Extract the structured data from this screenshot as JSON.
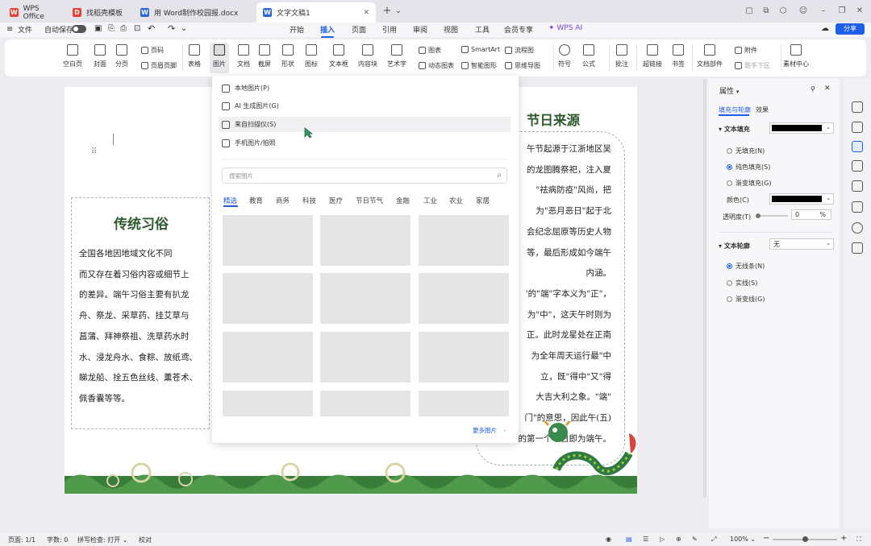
{
  "tabs": [
    {
      "label": "WPS Office",
      "icon": "wps-logo-icon",
      "color": "#e8402e"
    },
    {
      "label": "找稻壳模板",
      "icon": "docer-icon",
      "color": "#e8402e"
    },
    {
      "label": "用 Word制作校园报.docx",
      "icon": "word-doc-icon",
      "color": "#2b66d9"
    },
    {
      "label": "文字文稿1",
      "icon": "word-doc-icon",
      "color": "#2b66d9"
    }
  ],
  "menubar": {
    "file": "文件",
    "autosave": "自动保存",
    "tabs": [
      "开始",
      "插入",
      "页面",
      "引用",
      "审阅",
      "视图",
      "工具",
      "会员专享",
      "WPS AI"
    ],
    "active_tab": "插入",
    "share": "分享"
  },
  "ribbon": {
    "buttons": [
      "空白页",
      "封面",
      "分页",
      "表格",
      "图片",
      "文档",
      "截屏",
      "形状",
      "图标",
      "文本框",
      "内容块",
      "艺术字",
      "符号",
      "公式",
      "批注",
      "超链接",
      "书签",
      "文档部件",
      "素材中心"
    ],
    "small": {
      "page_num": "页码",
      "header_footer": "页眉页脚",
      "chart": "图表",
      "smartart": "SmartArt",
      "dynamic_chart": "动态图表",
      "smart_shape": "智能图形",
      "flowchart": "流程图",
      "mindmap": "思维导图",
      "attachment": "附件",
      "prev_next": "题手下区"
    }
  },
  "picture_menu": {
    "items": [
      "本地图片(P)",
      "AI 生成图片(G)",
      "来自扫描仪(S)",
      "手机图片/拍照"
    ],
    "search_placeholder": "搜索图片",
    "categories": [
      "精选",
      "教育",
      "商务",
      "科技",
      "医疗",
      "节日节气",
      "金融",
      "工业",
      "农业",
      "家居"
    ],
    "active_category": "精选",
    "more": "更多图片"
  },
  "document": {
    "left_title": "传统习俗",
    "left_lines": [
      "全国各地因地域文化不同",
      "而又存在着习俗内容或细节上",
      "的差异。端午习俗主要有扒龙",
      "舟、祭龙、采草药、挂艾草与",
      "菖蒲、拜神祭祖、洗草药水时",
      "水、浸龙舟水、食粽、放纸鸢、",
      "睇龙船、拴五色丝线、薰苍术、",
      "佩香囊等等。"
    ],
    "right_title": "节日来源",
    "right_lines": [
      "午节起源于江浙地区吴",
      "的龙图腾祭祀，注入夏",
      "\"祛病防疫\"风尚，把",
      "为\"恶月恶日\"起于北",
      "会纪念屈原等历史人物",
      "等，最后形成如今端午",
      "内涵。",
      "'的\"端\"字本义为\"正\"，",
      "为\"中\"，这天午时则为",
      "正。此时龙星处在正南",
      "为全年周天运行最\"中",
      "立，既\"得中\"又\"得",
      "大吉大利之象。\"端\"",
      "门\"的意思，因此午(五)",
      "月的第一个午日即为端午。"
    ]
  },
  "panel": {
    "title": "属性",
    "tabs": [
      "填充与轮廓",
      "效果"
    ],
    "fill_section": "文本填充",
    "fill_options": [
      "无填充(N)",
      "纯色填充(S)",
      "渐变填充(G)"
    ],
    "color_label": "颜色(C)",
    "transparency_label": "透明度(T)",
    "transparency_value": "0",
    "percent": "%",
    "outline_section": "文本轮廓",
    "outline_value": "无",
    "outline_options": [
      "无线条(N)",
      "实线(S)",
      "渐变线(G)"
    ]
  },
  "status": {
    "page": "页面: 1/1",
    "words": "字数: 0",
    "spell": "拼写检查: 打开",
    "proof": "校对",
    "zoom": "100%"
  },
  "colors": {
    "accent": "#1c5ee6",
    "heading_green": "#2e5a2d",
    "fill_black": "#000000"
  }
}
